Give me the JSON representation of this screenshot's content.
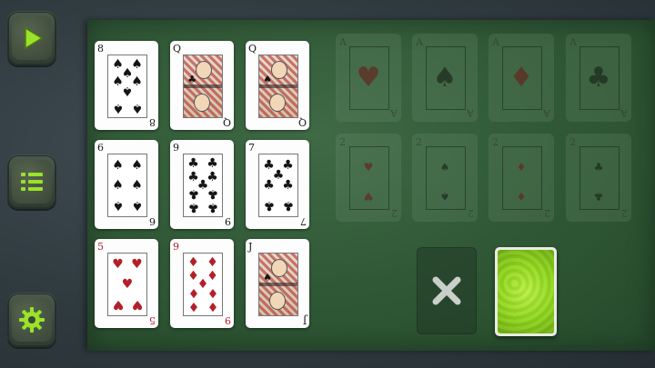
{
  "sidebar": {
    "buttons": [
      {
        "name": "play-icon"
      },
      {
        "name": "menu-list-icon"
      },
      {
        "name": "gear-icon"
      }
    ],
    "accent": "#8fd61c"
  },
  "tableau": {
    "rows": [
      [
        {
          "rank": "8",
          "suit": "♠",
          "color": "black"
        },
        {
          "rank": "Q",
          "suit": "♣",
          "color": "black",
          "court": true
        },
        {
          "rank": "Q",
          "suit": "♠",
          "color": "black",
          "court": true
        }
      ],
      [
        {
          "rank": "6",
          "suit": "♠",
          "color": "black"
        },
        {
          "rank": "9",
          "suit": "♣",
          "color": "black"
        },
        {
          "rank": "7",
          "suit": "♣",
          "color": "black"
        }
      ],
      [
        {
          "rank": "5",
          "suit": "♥",
          "color": "red"
        },
        {
          "rank": "9",
          "suit": "♦",
          "color": "red"
        },
        {
          "rank": "J",
          "suit": "♠",
          "color": "black",
          "court": true
        }
      ]
    ]
  },
  "foundations": {
    "top": [
      {
        "rank": "A",
        "suit": "♥",
        "color": "red"
      },
      {
        "rank": "A",
        "suit": "♠",
        "color": "black"
      },
      {
        "rank": "A",
        "suit": "♦",
        "color": "red"
      },
      {
        "rank": "A",
        "suit": "♣",
        "color": "black"
      }
    ],
    "bottom": [
      {
        "rank": "2",
        "suit": "♥",
        "color": "red"
      },
      {
        "rank": "2",
        "suit": "♠",
        "color": "black"
      },
      {
        "rank": "2",
        "suit": "♦",
        "color": "red"
      },
      {
        "rank": "2",
        "suit": "♣",
        "color": "black"
      }
    ]
  },
  "controls": {
    "discard_icon": "close-x-icon",
    "stock_back_color": "#8fd61c"
  },
  "colors": {
    "felt": "#305836",
    "red_suit": "#b3202a",
    "black_suit": "#151515"
  }
}
